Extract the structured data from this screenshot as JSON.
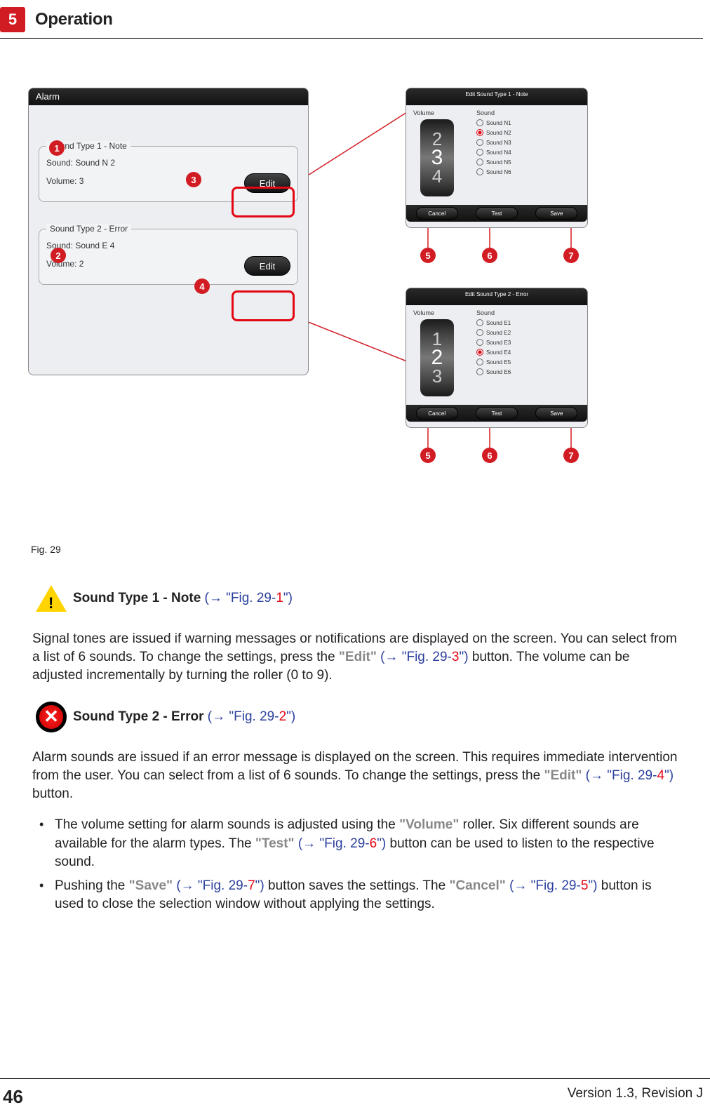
{
  "header": {
    "chapter": "5",
    "title": "Operation"
  },
  "figure": {
    "caption": "Fig. 29",
    "alarm": {
      "title": "Alarm",
      "group1": {
        "legend": "Sound Type 1 - Note",
        "sound": "Sound: Sound N 2",
        "volume": "Volume: 3",
        "edit": "Edit"
      },
      "group2": {
        "legend": "Sound Type 2 - Error",
        "sound": "Sound: Sound E 4",
        "volume": "Volume: 2",
        "edit": "Edit"
      }
    },
    "editNote": {
      "title": "Edit Sound Type 1 - Note",
      "volLabel": "Volume",
      "sndLabel": "Sound",
      "rollerTop": "2",
      "rollerMid": "3",
      "rollerBot": "4",
      "options": [
        "Sound N1",
        "Sound N2",
        "Sound N3",
        "Sound N4",
        "Sound N5",
        "Sound N6"
      ],
      "selected": 1,
      "cancel": "Cancel",
      "test": "Test",
      "save": "Save"
    },
    "editError": {
      "title": "Edit Sound Type 2 - Error",
      "volLabel": "Volume",
      "sndLabel": "Sound",
      "rollerTop": "1",
      "rollerMid": "2",
      "rollerBot": "3",
      "options": [
        "Sound E1",
        "Sound E2",
        "Sound E3",
        "Sound E4",
        "Sound E5",
        "Sound E6"
      ],
      "selected": 3,
      "cancel": "Cancel",
      "test": "Test",
      "save": "Save"
    },
    "callouts": {
      "d1": "1",
      "d2": "2",
      "d3": "3",
      "d4": "4",
      "d5": "5",
      "d6": "6",
      "d7": "7"
    }
  },
  "text": {
    "h1_title": "Sound Type 1 - Note ",
    "h1_ref_open": "(→ ",
    "h1_ref_fig": "\"Fig. 29-",
    "h1_ref_num": "1",
    "h1_ref_close": "\")",
    "p1a": "Signal tones are issued if warning messages or notifications are displayed on the screen. You can select from a list of 6 sounds. To change the settings, press the ",
    "p1_edit": "\"Edit\"",
    "p1b": " ",
    "p1_ref_open": "(→ ",
    "p1_ref_fig": "\"Fig. 29-",
    "p1_ref_num": "3",
    "p1_ref_close": "\")",
    "p1c": " button. The volume can be adjusted incrementally by turning the roller (0 to 9).",
    "h2_title": "Sound Type 2 - Error ",
    "h2_ref_open": "(→ ",
    "h2_ref_fig": "\"Fig. 29-",
    "h2_ref_num": "2",
    "h2_ref_close": "\")",
    "p2a": "Alarm sounds are issued if an error message is displayed on the screen. This requires immediate intervention from the user. You can select from a list of 6 sounds. To change the settings, press the ",
    "p2_edit": "\"Edit\"",
    "p2b": " ",
    "p2_ref_open": "(→ ",
    "p2_ref_fig": "\"Fig. 29-",
    "p2_ref_num": "4",
    "p2_ref_close": "\")",
    "p2c": " button.",
    "b1a": "The volume setting for alarm sounds is adjusted using the ",
    "b1_vol": "\"Volume\"",
    "b1b": " roller. Six different sounds are available for the alarm types. The ",
    "b1_test": "\"Test\"",
    "b1c": " ",
    "b1_ref_open": "(→ ",
    "b1_ref_fig": "\"Fig. 29-",
    "b1_ref_num": "6",
    "b1_ref_close": "\")",
    "b1d": " button can be used to listen to the respective sound.",
    "b2a": "Pushing the ",
    "b2_save": "\"Save\"",
    "b2b": " ",
    "b2_ref1_open": "(→ ",
    "b2_ref1_fig": "\"Fig. 29-",
    "b2_ref1_num": "7",
    "b2_ref1_close": "\")",
    "b2c": " button saves the settings. The ",
    "b2_cancel": "\"Cancel\"",
    "b2d": " ",
    "b2_ref2_open": "(→ ",
    "b2_ref2_fig": "\"Fig. 29-",
    "b2_ref2_num": "5",
    "b2_ref2_close": "\")",
    "b2e": " button is used to close the selection window without applying the settings."
  },
  "footer": {
    "page": "46",
    "version": "Version 1.3, Revision J"
  }
}
